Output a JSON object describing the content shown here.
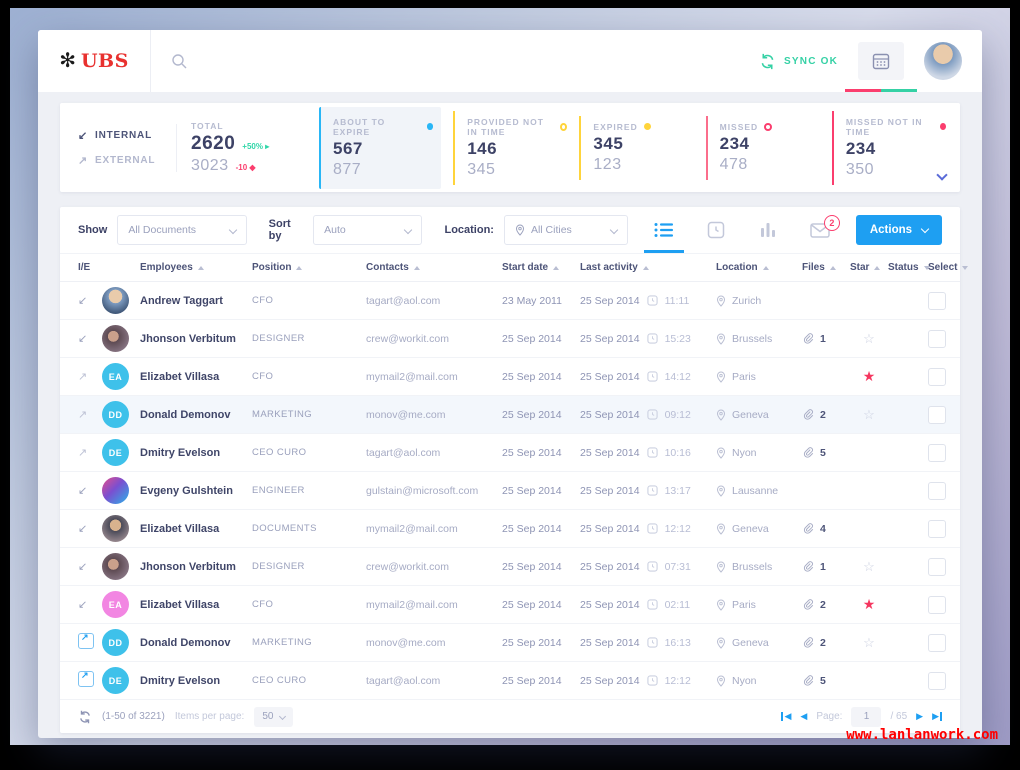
{
  "colors": {
    "accent_blue": "#1e9ff2",
    "teal": "#2fd6a8",
    "red": "#f5365f",
    "pink": "#fb3e6e",
    "yellow": "#ffd43b",
    "green": "#2fe06a",
    "cyan_avatar": "#3ec1ea",
    "pink_avatar": "#f286e2",
    "ubs_red": "#e8312f"
  },
  "topbar": {
    "logo_text": "UBS",
    "sync_label": "SYNC OK"
  },
  "stats": {
    "internal_label": "INTERNAL",
    "external_label": "EXTERNAL",
    "total_label": "TOTAL",
    "total_internal": "2620",
    "total_internal_delta": "+50%",
    "total_external": "3023",
    "total_external_delta": "-10",
    "cards": [
      {
        "label": "ABOUT TO EXPIRE",
        "value1": "567",
        "value2": "877"
      },
      {
        "label": "PROVIDED NOT IN TIME",
        "value1": "146",
        "value2": "345"
      },
      {
        "label": "EXPIRED",
        "value1": "345",
        "value2": "123"
      },
      {
        "label": "MISSED",
        "value1": "234",
        "value2": "478"
      },
      {
        "label": "MISSED NOT IN TIME",
        "value1": "234",
        "value2": "350"
      }
    ]
  },
  "filters": {
    "show_label": "Show",
    "show_value": "All Documents",
    "sort_label": "Sort by",
    "sort_value": "Auto",
    "location_label": "Location:",
    "location_value": "All Cities",
    "mail_badge": "2",
    "actions_label": "Actions"
  },
  "table": {
    "headers": [
      {
        "label": "I/E",
        "sort": null
      },
      {
        "label": "Employees",
        "sort": "asc"
      },
      {
        "label": "Position",
        "sort": "asc"
      },
      {
        "label": "Contacts",
        "sort": "asc"
      },
      {
        "label": "Start date",
        "sort": "asc"
      },
      {
        "label": "Last activity",
        "sort": "asc"
      },
      {
        "label": "Location",
        "sort": "asc"
      },
      {
        "label": "Files",
        "sort": "asc"
      },
      {
        "label": "Star",
        "sort": "asc"
      },
      {
        "label": "Status",
        "sort": "desc"
      },
      {
        "label": "Select",
        "sort": "desc"
      }
    ],
    "rows": [
      {
        "ie": "in",
        "avatar": {
          "type": "photo",
          "variant": 1
        },
        "name": "Andrew Taggart",
        "position": "CFO",
        "contact": "tagart@aol.com",
        "start_date": "23 May 2011",
        "last_date": "25 Sep 2014",
        "last_time": "11:11",
        "location": "Zurich",
        "files": null,
        "star": "none",
        "status": "blue",
        "highlight": false
      },
      {
        "ie": "in",
        "avatar": {
          "type": "photo",
          "variant": 2
        },
        "name": "Jhonson Verbitum",
        "position": "DESIGNER",
        "contact": "crew@workit.com",
        "start_date": "25 Sep 2014",
        "last_date": "25 Sep 2014",
        "last_time": "15:23",
        "location": "Brussels",
        "files": "1",
        "star": "outline",
        "status": "blue",
        "highlight": false
      },
      {
        "ie": "out",
        "avatar": {
          "type": "initials",
          "color": "cyan",
          "initials": "EA"
        },
        "name": "Elizabet Villasa",
        "position": "CFO",
        "contact": "mymail2@mail.com",
        "start_date": "25 Sep 2014",
        "last_date": "25 Sep 2014",
        "last_time": "14:12",
        "location": "Paris",
        "files": null,
        "star": "filled",
        "status": "blue",
        "highlight": false
      },
      {
        "ie": "out",
        "avatar": {
          "type": "initials",
          "color": "cyan",
          "initials": "DD"
        },
        "name": "Donald Demonov",
        "position": "MARKETING",
        "contact": "monov@me.com",
        "start_date": "25 Sep 2014",
        "last_date": "25 Sep 2014",
        "last_time": "09:12",
        "location": "Geneva",
        "files": "2",
        "star": "outline",
        "status": "blue",
        "highlight": true
      },
      {
        "ie": "out",
        "avatar": {
          "type": "initials",
          "color": "cyan",
          "initials": "DE"
        },
        "name": "Dmitry Evelson",
        "position": "CEO CURO",
        "contact": "tagart@aol.com",
        "start_date": "25 Sep 2014",
        "last_date": "25 Sep 2014",
        "last_time": "10:16",
        "location": "Nyon",
        "files": "5",
        "star": "none",
        "status": "green",
        "highlight": false
      },
      {
        "ie": "in",
        "avatar": {
          "type": "photo",
          "variant": 3
        },
        "name": "Evgeny Gulshtein",
        "position": "ENGINEER",
        "contact": "gulstain@microsoft.com",
        "start_date": "25 Sep 2014",
        "last_date": "25 Sep 2014",
        "last_time": "13:17",
        "location": "Lausanne",
        "files": null,
        "star": "none",
        "status": "yellow",
        "highlight": false
      },
      {
        "ie": "in",
        "avatar": {
          "type": "photo",
          "variant": 4
        },
        "name": "Elizabet Villasa",
        "position": "DOCUMENTS",
        "contact": "mymail2@mail.com",
        "start_date": "25 Sep 2014",
        "last_date": "25 Sep 2014",
        "last_time": "12:12",
        "location": "Geneva",
        "files": "4",
        "star": "none",
        "status": "red",
        "highlight": false
      },
      {
        "ie": "in",
        "avatar": {
          "type": "photo",
          "variant": 2
        },
        "name": "Jhonson Verbitum",
        "position": "DESIGNER",
        "contact": "crew@workit.com",
        "start_date": "25 Sep 2014",
        "last_date": "25 Sep 2014",
        "last_time": "07:31",
        "location": "Brussels",
        "files": "1",
        "star": "outline",
        "status": "blue",
        "highlight": false
      },
      {
        "ie": "in",
        "avatar": {
          "type": "initials",
          "color": "pink",
          "initials": "EA"
        },
        "name": "Elizabet Villasa",
        "position": "CFO",
        "contact": "mymail2@mail.com",
        "start_date": "25 Sep 2014",
        "last_date": "25 Sep 2014",
        "last_time": "02:11",
        "location": "Paris",
        "files": "2",
        "star": "filled",
        "status": null,
        "highlight": false
      },
      {
        "ie": "ext",
        "avatar": {
          "type": "initials",
          "color": "cyan",
          "initials": "DD"
        },
        "name": "Donald Demonov",
        "position": "MARKETING",
        "contact": "monov@me.com",
        "start_date": "25 Sep 2014",
        "last_date": "25 Sep 2014",
        "last_time": "16:13",
        "location": "Geneva",
        "files": "2",
        "star": "outline",
        "status": "blue",
        "highlight": false
      },
      {
        "ie": "ext",
        "avatar": {
          "type": "initials",
          "color": "cyan",
          "initials": "DE"
        },
        "name": "Dmitry Evelson",
        "position": "CEO CURO",
        "contact": "tagart@aol.com",
        "start_date": "25 Sep 2014",
        "last_date": "25 Sep 2014",
        "last_time": "12:12",
        "location": "Nyon",
        "files": "5",
        "star": "none",
        "status": "green",
        "highlight": false
      }
    ]
  },
  "footer": {
    "range_text": "(1-50 of 3221)",
    "items_per_page_label": "Items per page:",
    "items_per_page_value": "50",
    "page_label": "Page:",
    "page_value": "1",
    "page_total": "/ 65"
  },
  "watermark": "www.lanlanwork.com"
}
